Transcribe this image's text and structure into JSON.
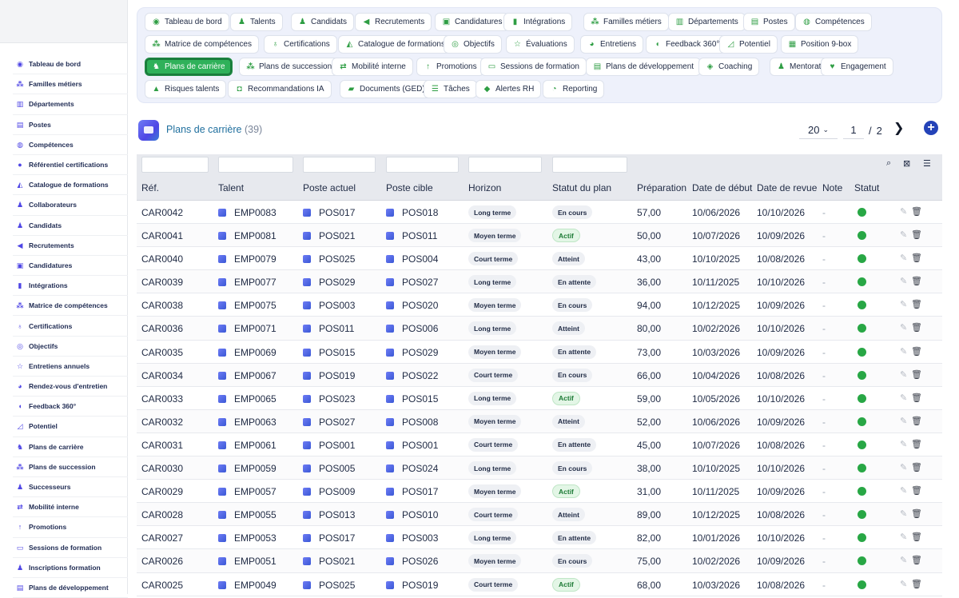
{
  "sidebar": {
    "items": [
      {
        "label": "Tableau de bord",
        "icon": "dashboard-icon",
        "glyph": "◉"
      },
      {
        "label": "Familles métiers",
        "icon": "sitemap-icon",
        "glyph": "⁂"
      },
      {
        "label": "Départements",
        "icon": "building-icon",
        "glyph": "▥"
      },
      {
        "label": "Postes",
        "icon": "id-badge-icon",
        "glyph": "▤"
      },
      {
        "label": "Compétences",
        "icon": "brain-icon",
        "glyph": "◍"
      },
      {
        "label": "Référentiel certifications",
        "icon": "certificate-icon",
        "glyph": "●"
      },
      {
        "label": "Catalogue de formations",
        "icon": "graduation-cap-icon",
        "glyph": "◭"
      },
      {
        "label": "Collaborateurs",
        "icon": "user-icon",
        "glyph": "♟"
      },
      {
        "label": "Candidats",
        "icon": "user-plus-icon",
        "glyph": "♟"
      },
      {
        "label": "Recrutements",
        "icon": "megaphone-icon",
        "glyph": "◀"
      },
      {
        "label": "Candidatures",
        "icon": "file-user-icon",
        "glyph": "▣"
      },
      {
        "label": "Intégrations",
        "icon": "door-icon",
        "glyph": "▮"
      },
      {
        "label": "Matrice de compétences",
        "icon": "grid-icon",
        "glyph": "⁂"
      },
      {
        "label": "Certifications",
        "icon": "award-icon",
        "glyph": "♁"
      },
      {
        "label": "Objectifs",
        "icon": "target-icon",
        "glyph": "◎"
      },
      {
        "label": "Entretiens annuels",
        "icon": "star-icon",
        "glyph": "☆"
      },
      {
        "label": "Rendez-vous d'entretien",
        "icon": "chat-icon",
        "glyph": "◕"
      },
      {
        "label": "Feedback 360°",
        "icon": "comment-icon",
        "glyph": "◖"
      },
      {
        "label": "Potentiel",
        "icon": "chart-line-icon",
        "glyph": "◿"
      },
      {
        "label": "Plans de carrière",
        "icon": "route-icon",
        "glyph": "♞"
      },
      {
        "label": "Plans de succession",
        "icon": "sitemap-icon",
        "glyph": "⁂"
      },
      {
        "label": "Successeurs",
        "icon": "users-icon",
        "glyph": "♟"
      },
      {
        "label": "Mobilité interne",
        "icon": "exchange-icon",
        "glyph": "⇄"
      },
      {
        "label": "Promotions",
        "icon": "arrow-up-icon",
        "glyph": "↑"
      },
      {
        "label": "Sessions de formation",
        "icon": "chalkboard-icon",
        "glyph": "▭"
      },
      {
        "label": "Inscriptions formation",
        "icon": "user-check-icon",
        "glyph": "♟"
      },
      {
        "label": "Plans de développement",
        "icon": "clipboard-icon",
        "glyph": "▤"
      }
    ]
  },
  "tabs": [
    {
      "label": "Tableau de bord",
      "icon": "dashboard-icon",
      "glyph": "◉",
      "active": false
    },
    {
      "label": "Talents",
      "icon": "user-icon",
      "glyph": "♟",
      "active": false
    },
    {
      "label": "Candidats",
      "icon": "user-plus-icon",
      "glyph": "♟",
      "active": false
    },
    {
      "label": "Recrutements",
      "icon": "megaphone-icon",
      "glyph": "◀",
      "active": false
    },
    {
      "label": "Candidatures",
      "icon": "file-user-icon",
      "glyph": "▣",
      "active": false
    },
    {
      "label": "Intégrations",
      "icon": "door-icon",
      "glyph": "▮",
      "active": false
    },
    {
      "label": "Familles métiers",
      "icon": "sitemap-icon",
      "glyph": "⁂",
      "active": false
    },
    {
      "label": "Départements",
      "icon": "building-icon",
      "glyph": "▥",
      "active": false
    },
    {
      "label": "Postes",
      "icon": "id-badge-icon",
      "glyph": "▤",
      "active": false
    },
    {
      "label": "Compétences",
      "icon": "brain-icon",
      "glyph": "◍",
      "active": false
    },
    {
      "label": "Matrice de compétences",
      "icon": "grid-icon",
      "glyph": "⁂",
      "active": false
    },
    {
      "label": "Certifications",
      "icon": "award-icon",
      "glyph": "♁",
      "active": false
    },
    {
      "label": "Catalogue de formations",
      "icon": "graduation-cap-icon",
      "glyph": "◭",
      "active": false
    },
    {
      "label": "Objectifs",
      "icon": "target-icon",
      "glyph": "◎",
      "active": false
    },
    {
      "label": "Évaluations",
      "icon": "star-icon",
      "glyph": "☆",
      "active": false
    },
    {
      "label": "Entretiens",
      "icon": "chat-icon",
      "glyph": "◕",
      "active": false
    },
    {
      "label": "Feedback 360°",
      "icon": "comment-icon",
      "glyph": "◖",
      "active": false
    },
    {
      "label": "Potentiel",
      "icon": "chart-line-icon",
      "glyph": "◿",
      "active": false
    },
    {
      "label": "Position 9-box",
      "icon": "grid-nine-icon",
      "glyph": "▦",
      "active": false
    },
    {
      "label": "Plans de carrière",
      "icon": "route-icon",
      "glyph": "♞",
      "active": true
    },
    {
      "label": "Plans de succession",
      "icon": "sitemap-icon",
      "glyph": "⁂",
      "active": false
    },
    {
      "label": "Mobilité interne",
      "icon": "exchange-icon",
      "glyph": "⇄",
      "active": false
    },
    {
      "label": "Promotions",
      "icon": "arrow-up-icon",
      "glyph": "↑",
      "active": false
    },
    {
      "label": "Sessions de formation",
      "icon": "chalkboard-icon",
      "glyph": "▭",
      "active": false
    },
    {
      "label": "Plans de développement",
      "icon": "clipboard-icon",
      "glyph": "▤",
      "active": false
    },
    {
      "label": "Coaching",
      "icon": "handshake-icon",
      "glyph": "◈",
      "active": false
    },
    {
      "label": "Mentorat",
      "icon": "user-tie-icon",
      "glyph": "♟",
      "active": false
    },
    {
      "label": "Engagement",
      "icon": "heart-icon",
      "glyph": "♥",
      "active": false
    },
    {
      "label": "Risques talents",
      "icon": "warning-icon",
      "glyph": "▲",
      "active": false
    },
    {
      "label": "Recommandations IA",
      "icon": "robot-icon",
      "glyph": "◘",
      "active": false
    },
    {
      "label": "Documents (GED)",
      "icon": "folder-icon",
      "glyph": "▰",
      "active": false
    },
    {
      "label": "Tâches",
      "icon": "list-check-icon",
      "glyph": "☰",
      "active": false
    },
    {
      "label": "Alertes RH",
      "icon": "bell-icon",
      "glyph": "◆",
      "active": false
    },
    {
      "label": "Reporting",
      "icon": "pie-chart-icon",
      "glyph": "◔",
      "active": false
    }
  ],
  "page": {
    "title": "Plans de carrière",
    "count": "(39)",
    "page_size": "20",
    "current_page": "1",
    "page_separator": "/",
    "total_pages": "2",
    "next_label": "❯",
    "add_label": "+"
  },
  "table": {
    "columns": [
      "Réf.",
      "Talent",
      "Poste actuel",
      "Poste cible",
      "Horizon",
      "Statut du plan",
      "Préparation",
      "Date de début",
      "Date de revue",
      "Note",
      "Statut"
    ],
    "rows": [
      [
        "CAR0042",
        "EMP0083",
        "POS017",
        "POS018",
        "Long terme",
        "En cours",
        "57,00",
        "10/06/2026",
        "10/10/2026",
        "-"
      ],
      [
        "CAR0041",
        "EMP0081",
        "POS021",
        "POS011",
        "Moyen terme",
        "Actif",
        "50,00",
        "10/07/2026",
        "10/09/2026",
        "-"
      ],
      [
        "CAR0040",
        "EMP0079",
        "POS025",
        "POS004",
        "Court terme",
        "Atteint",
        "43,00",
        "10/10/2025",
        "10/08/2026",
        "-"
      ],
      [
        "CAR0039",
        "EMP0077",
        "POS029",
        "POS027",
        "Long terme",
        "En attente",
        "36,00",
        "10/11/2025",
        "10/10/2026",
        "-"
      ],
      [
        "CAR0038",
        "EMP0075",
        "POS003",
        "POS020",
        "Moyen terme",
        "En cours",
        "94,00",
        "10/12/2025",
        "10/09/2026",
        "-"
      ],
      [
        "CAR0036",
        "EMP0071",
        "POS011",
        "POS006",
        "Long terme",
        "Atteint",
        "80,00",
        "10/02/2026",
        "10/10/2026",
        "-"
      ],
      [
        "CAR0035",
        "EMP0069",
        "POS015",
        "POS029",
        "Moyen terme",
        "En attente",
        "73,00",
        "10/03/2026",
        "10/09/2026",
        "-"
      ],
      [
        "CAR0034",
        "EMP0067",
        "POS019",
        "POS022",
        "Court terme",
        "En cours",
        "66,00",
        "10/04/2026",
        "10/08/2026",
        "-"
      ],
      [
        "CAR0033",
        "EMP0065",
        "POS023",
        "POS015",
        "Long terme",
        "Actif",
        "59,00",
        "10/05/2026",
        "10/10/2026",
        "-"
      ],
      [
        "CAR0032",
        "EMP0063",
        "POS027",
        "POS008",
        "Moyen terme",
        "Atteint",
        "52,00",
        "10/06/2026",
        "10/09/2026",
        "-"
      ],
      [
        "CAR0031",
        "EMP0061",
        "POS001",
        "POS001",
        "Court terme",
        "En attente",
        "45,00",
        "10/07/2026",
        "10/08/2026",
        "-"
      ],
      [
        "CAR0030",
        "EMP0059",
        "POS005",
        "POS024",
        "Long terme",
        "En cours",
        "38,00",
        "10/10/2025",
        "10/10/2026",
        "-"
      ],
      [
        "CAR0029",
        "EMP0057",
        "POS009",
        "POS017",
        "Moyen terme",
        "Actif",
        "31,00",
        "10/11/2025",
        "10/09/2026",
        "-"
      ],
      [
        "CAR0028",
        "EMP0055",
        "POS013",
        "POS010",
        "Court terme",
        "Atteint",
        "89,00",
        "10/12/2025",
        "10/08/2026",
        "-"
      ],
      [
        "CAR0027",
        "EMP0053",
        "POS017",
        "POS003",
        "Long terme",
        "En attente",
        "82,00",
        "10/01/2026",
        "10/10/2026",
        "-"
      ],
      [
        "CAR0026",
        "EMP0051",
        "POS021",
        "POS026",
        "Moyen terme",
        "En cours",
        "75,00",
        "10/02/2026",
        "10/09/2026",
        "-"
      ],
      [
        "CAR0025",
        "EMP0049",
        "POS025",
        "POS019",
        "Court terme",
        "Actif",
        "68,00",
        "10/03/2026",
        "10/08/2026",
        "-"
      ]
    ],
    "status_color": "#28a745",
    "accent_color": "#2fb15a"
  }
}
